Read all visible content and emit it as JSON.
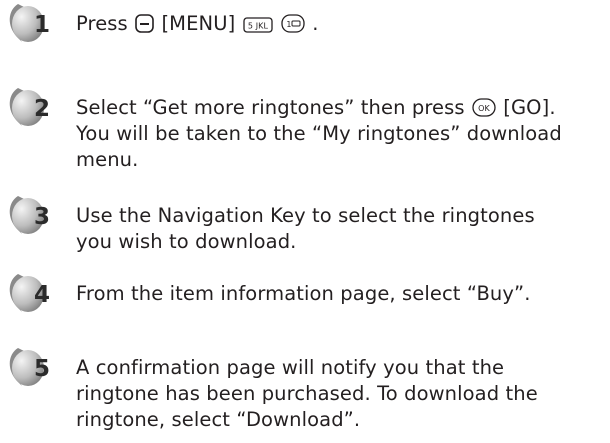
{
  "steps": [
    {
      "number": "1",
      "parts": [
        "Press",
        "[MENU]",
        "."
      ],
      "keys": [
        "left-soft-key-icon",
        "key-5-jkl-icon",
        "key-1-voicemail-icon"
      ]
    },
    {
      "number": "2",
      "line1_a": "Select “Get more ringtones” then press",
      "line1_b": "[GO].",
      "line2": "You will be taken to the “My ringtones” download",
      "line3": "menu.",
      "keys": [
        "ok-key-icon"
      ]
    },
    {
      "number": "3",
      "line1": "Use the Navigation Key to select the ringtones",
      "line2": "you wish to download."
    },
    {
      "number": "4",
      "line1": "From the item information page, select “Buy”."
    },
    {
      "number": "5",
      "line1": "A confirmation page will notify you that the",
      "line2": "ringtone has been purchased. To download the",
      "line3": "ringtone, select “Download”."
    }
  ],
  "key_labels": {
    "key5": "5 JKL",
    "key1": "1",
    "ok": "OK"
  },
  "colors": {
    "text": "#231f20",
    "badge_dark": "#8a8a8a",
    "badge_light": "#e6e6e6"
  }
}
